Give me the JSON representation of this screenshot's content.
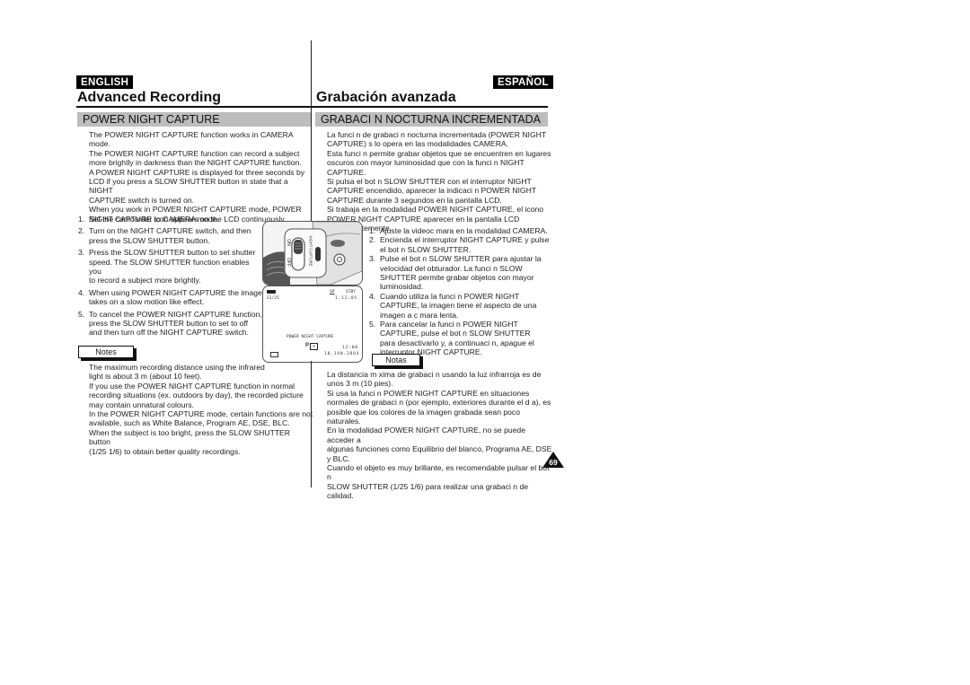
{
  "english": {
    "language_badge": "ENGLISH",
    "page_title": "Advanced Recording",
    "section_title": "POWER NIGHT CAPTURE",
    "intro": [
      "The POWER NIGHT CAPTURE function works in CAMERA mode.",
      "The POWER NIGHT CAPTURE function can record a subject",
      "more brightly in darkness than the NIGHT CAPTURE function.",
      "A POWER NIGHT CAPTURE is displayed for three seconds by",
      "LCD if you press a SLOW SHUTTER button in state that a NIGHT",
      "CAPTURE switch is turned on.",
      "When you work in POWER NIGHT CAPTURE mode, POWER",
      "NIGHT CAPTURE icon appears on the LCD continuously."
    ],
    "steps": [
      {
        "num": "1.",
        "lines": [
          "Set the camcorder to CAMERA mode."
        ]
      },
      {
        "num": "2.",
        "lines": [
          "Turn on the NIGHT CAPTURE switch, and then",
          "press the SLOW SHUTTER button."
        ]
      },
      {
        "num": "3.",
        "lines": [
          "Press the SLOW SHUTTER button to set shutter",
          "speed. The SLOW SHUTTER function enables you",
          "to record a subject more brightly."
        ]
      },
      {
        "num": "4.",
        "lines": [
          "When using POWER NIGHT CAPTURE the image",
          "takes on a slow motion like effect."
        ]
      },
      {
        "num": "5.",
        "lines": [
          "To cancel the POWER NIGHT CAPTURE function,",
          "press the SLOW SHUTTER button to set to  off",
          "and then turn off the NIGHT CAPTURE switch."
        ]
      }
    ],
    "notes_label": "Notes",
    "notes": [
      "The maximum recording distance using the infrared",
      "light is about 3 m (about 10 feet).",
      "If you use the POWER NIGHT CAPTURE function in normal",
      "recording situations (ex. outdoors by day), the recorded picture",
      "may contain unnatural colours.",
      "In the POWER NIGHT CAPTURE mode, certain functions are not",
      "available, such as White Balance, Program AE, DSE, BLC.",
      "When the subject is too bright, press the SLOW SHUTTER button",
      "(1/25     1/6) to obtain better quality recordings."
    ]
  },
  "spanish": {
    "language_badge": "ESPAÑOL",
    "page_title": "Grabación avanzada",
    "section_title": "GRABACI N NOCTURNA INCREMENTADA",
    "intro": [
      "La funci  n de grabaci  n nocturna incrementada (POWER NIGHT",
      "CAPTURE) s  lo opera en las modalidades CAMERA.",
      "Esta funci  n permite grabar objetos que se encuentren en lugares",
      "oscuros con mayor luminosidad que con la funci  n NIGHT CAPTURE.",
      "Si pulsa el bot  n SLOW SHUTTER con el interruptor NIGHT",
      "CAPTURE encendido, aparecer   la indicaci  n POWER NIGHT",
      "CAPTURE durante 3 segundos en la pantalla LCD.",
      "Si trabaja en la modalidad POWER NIGHT CAPTURE, el icono",
      "POWER NIGHT CAPTURE aparecer   en la pantalla LCD",
      "permanentemente."
    ],
    "steps": [
      {
        "num": "1.",
        "lines": [
          "Ajuste la videoc  mara en la modalidad CAMERA."
        ]
      },
      {
        "num": "2.",
        "lines": [
          "Encienda el interruptor NIGHT CAPTURE y pulse",
          "el bot  n SLOW SHUTTER."
        ]
      },
      {
        "num": "3.",
        "lines": [
          "Pulse el bot  n SLOW SHUTTER para ajustar la",
          "velocidad del obturador. La funci  n SLOW",
          "SHUTTER permite grabar objetos con mayor",
          "luminosidad."
        ]
      },
      {
        "num": "4.",
        "lines": [
          "Cuando utiliza la funci  n POWER NIGHT",
          "CAPTURE, la imagen tiene el aspecto de una",
          "imagen a c  mara lenta."
        ]
      },
      {
        "num": "5.",
        "lines": [
          "Para cancelar la funci  n POWER NIGHT",
          "CAPTURE, pulse el bot  n SLOW SHUTTER",
          "para desactivarlo y, a continuaci  n, apague el",
          "interruptor NIGHT CAPTURE."
        ]
      }
    ],
    "notes_label": "Notas",
    "notes": [
      "La distancia m  xima de grabaci  n usando la luz infrarroja es de",
      "unos 3 m (10 pies).",
      "Si usa la funci  n POWER NIGHT CAPTURE en situaciones",
      "normales de grabaci  n (por ejemplo, exteriores durante el d  a), es",
      "posible que los colores de la imagen grabada sean poco naturales.",
      "En la modalidad POWER NIGHT CAPTURE, no se puede acceder a",
      "algunas funciones como Equilibrio del blanco, Programa AE, DSE y BLC.",
      "Cuando el objeto es muy brillante, es recomendable pulsar el bot  n",
      "SLOW SHUTTER (1/25     1/6) para realizar una grabaci  n de",
      "calidad."
    ]
  },
  "illustration": {
    "switch_label": "NIGHT CAPTURE",
    "on_label": "ON",
    "off_label": "OFF"
  },
  "lcd": {
    "mode": "SP",
    "status": "STBY",
    "shutter": "S1/25",
    "counter": "1:12:05",
    "message": "POWER NIGHT CAPTURE",
    "icon_label": "P",
    "time": "12:00",
    "date": "10.JAN.2004"
  },
  "page_number": "69"
}
